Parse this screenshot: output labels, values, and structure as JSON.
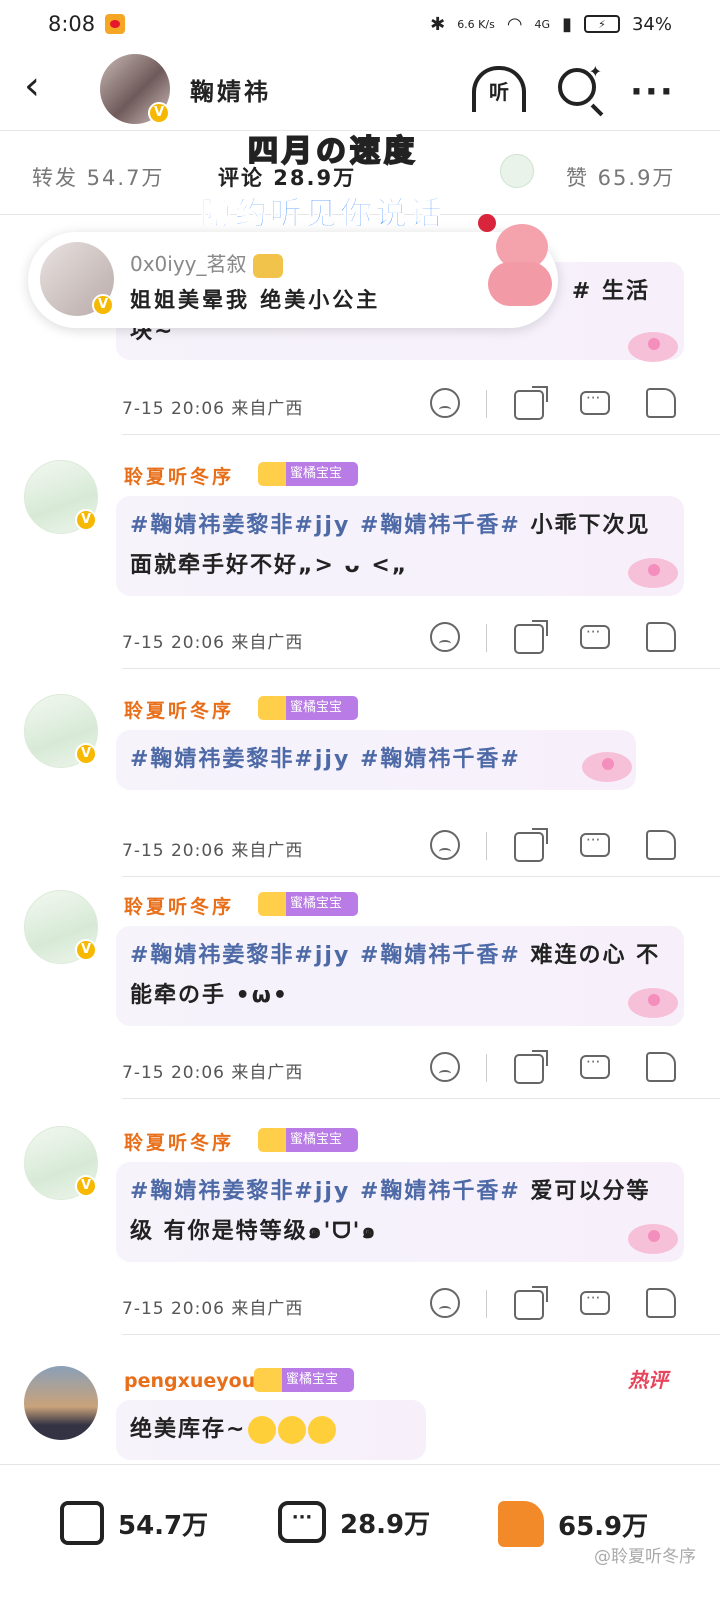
{
  "status_bar": {
    "time": "8:08",
    "net_speed": "6.6 K/s",
    "signal": "4G",
    "battery": "34%"
  },
  "header": {
    "name": "鞠婧祎",
    "listen_label": "听"
  },
  "stats": {
    "repost": "转发 54.7万",
    "comment": "评论 28.9万",
    "like": "赞 65.9万"
  },
  "banner": {
    "top": "四月の速度",
    "middle": "隐约听见你说话"
  },
  "popup": {
    "username": "0x0iyy_茗叙",
    "text": "姐姐美晕我 绝美小公主"
  },
  "first_comment_partial": {
    "tail": "# 生活",
    "line2": "块~",
    "time": "7-15 20:06",
    "location": "来自广西"
  },
  "comments": [
    {
      "name": "聆夏听冬序",
      "badge": "蜜橘宝宝",
      "tags": "#鞠婧祎姜黎非#jjy #鞠婧祎千香#",
      "text": " 小乖下次见面就牵手好不好„> ᴗ <„",
      "time": "7-15 20:06",
      "location": "来自广西"
    },
    {
      "name": "聆夏听冬序",
      "badge": "蜜橘宝宝",
      "tags": "#鞠婧祎姜黎非#jjy #鞠婧祎千香#",
      "text": "",
      "time": "7-15 20:06",
      "location": "来自广西"
    },
    {
      "name": "聆夏听冬序",
      "badge": "蜜橘宝宝",
      "tags": "#鞠婧祎姜黎非#jjy #鞠婧祎千香#",
      "text": " 难连の心 不能牵の手 •ω•",
      "time": "7-15 20:06",
      "location": "来自广西"
    },
    {
      "name": "聆夏听冬序",
      "badge": "蜜橘宝宝",
      "tags": "#鞠婧祎姜黎非#jjy #鞠婧祎千香#",
      "text": " 爱可以分等级 有你是特等级๑'ᗜ'๑",
      "time": "7-15 20:06",
      "location": "来自广西"
    }
  ],
  "last_comment": {
    "name": "pengxueyou",
    "badge": "蜜橘宝宝",
    "text": "绝美库存~",
    "hot": "热评"
  },
  "bottom_bar": {
    "repost": "54.7万",
    "comment": "28.9万",
    "like": "65.9万"
  },
  "watermark": "@聆夏听冬序",
  "colors": {
    "username_orange": "#e86f1a",
    "tag_blue": "#4d6aa7",
    "like_orange": "#f28a2a"
  }
}
